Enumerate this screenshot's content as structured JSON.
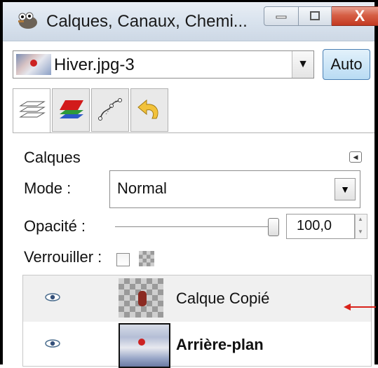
{
  "window": {
    "title": "Calques, Canaux, Chemi...",
    "close_symbol": "X"
  },
  "image_selector": {
    "value": "Hiver.jpg-3",
    "auto_label": "Auto"
  },
  "tabs": [
    {
      "icon": "layers-icon"
    },
    {
      "icon": "channels-icon"
    },
    {
      "icon": "paths-icon"
    },
    {
      "icon": "undo-history-icon"
    }
  ],
  "layers_panel": {
    "title": "Calques",
    "mode_label": "Mode :",
    "mode_value": "Normal",
    "opacity_label": "Opacité :",
    "opacity_value": "100,0",
    "lock_label": "Verrouiller :"
  },
  "layers": [
    {
      "name": "Calque Copié",
      "visible": true,
      "bold": false,
      "selected": true
    },
    {
      "name": "Arrière-plan",
      "visible": true,
      "bold": true,
      "selected": false
    }
  ],
  "colors": {
    "annotation_arrow": "#d9231a",
    "close_button": "#c33a22"
  }
}
